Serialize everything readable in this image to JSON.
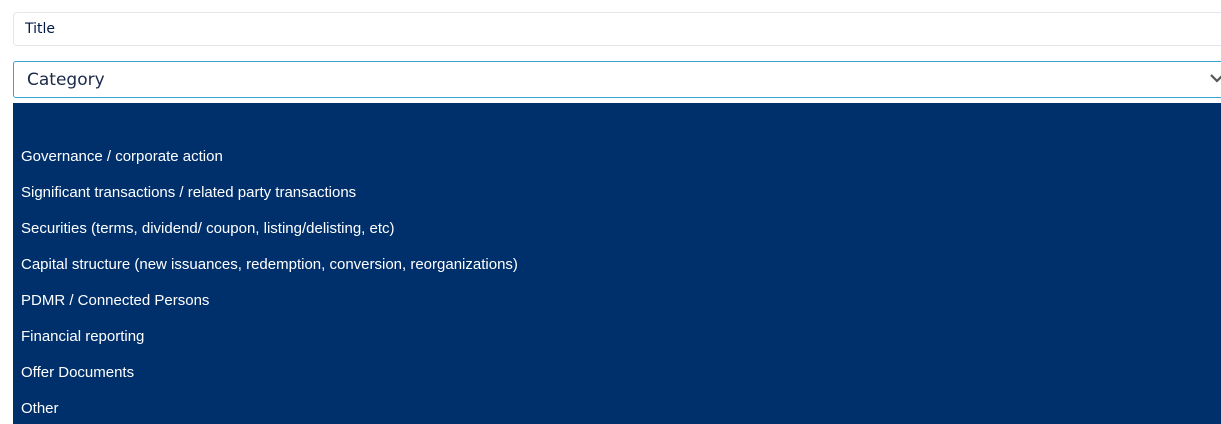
{
  "form": {
    "title_placeholder": "Title",
    "category_value": "Category"
  },
  "dropdown": {
    "options": [
      "",
      "Governance / corporate action",
      "Significant transactions / related party transactions",
      "Securities (terms, dividend/ coupon, listing/delisting, etc)",
      "Capital structure (new issuances, redemption, conversion, reorganizations)",
      "PDMR / Connected Persons",
      "Financial reporting",
      "Offer Documents",
      "Other"
    ]
  },
  "colors": {
    "dropdown_background": "#00306c",
    "select_focus_border": "#3ba4cf",
    "option_text": "#ffffff"
  },
  "icons": {
    "select_arrow": "chevron-down-icon"
  }
}
